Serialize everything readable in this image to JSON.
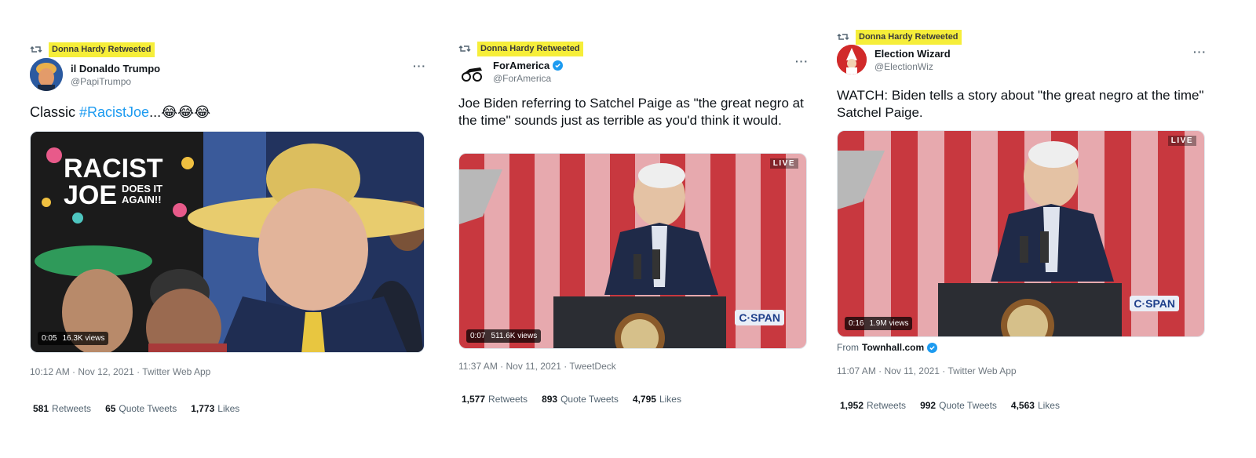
{
  "tweets": [
    {
      "retweeted_by": "Donna Hardy Retweeted",
      "display_name": "il Donaldo Trumpo",
      "handle": "@PapiTrumpo",
      "text_prefix": "Classic ",
      "hashtag": "#RacistJoe",
      "text_suffix": "...😂😂😂",
      "media_text_line1": "RACIST",
      "media_text_line2": "JOE",
      "media_text_line3": "DOES IT",
      "media_text_line4": "AGAIN!!",
      "video_time": "0:05",
      "video_views": "16.3K views",
      "timestamp": "10:12 AM · Nov 12, 2021 · Twitter Web App",
      "retweets_count": "581",
      "retweets_label": "Retweets",
      "quote_count": "65",
      "quote_label": "Quote Tweets",
      "likes_count": "1,773",
      "likes_label": "Likes"
    },
    {
      "retweeted_by": "Donna Hardy Retweeted",
      "display_name": "ForAmerica",
      "handle": "@ForAmerica",
      "text": "Joe Biden referring to Satchel Paige as \"the great negro at the time\" sounds just as terrible as you'd think it would.",
      "live_label": "LIVE",
      "network_label": "C·SPAN",
      "video_time": "0:07",
      "video_views": "511.6K views",
      "timestamp": "11:37 AM · Nov 11, 2021 · TweetDeck",
      "retweets_count": "1,577",
      "retweets_label": "Retweets",
      "quote_count": "893",
      "quote_label": "Quote Tweets",
      "likes_count": "4,795",
      "likes_label": "Likes"
    },
    {
      "retweeted_by": "Donna Hardy Retweeted",
      "display_name": "Election Wizard",
      "handle": "@ElectionWiz",
      "text": "WATCH: Biden tells a story about \"the great negro at the time\" Satchel Paige.",
      "live_label": "LIVE",
      "network_label": "C·SPAN",
      "video_time": "0:16",
      "video_views": "1.9M views",
      "from_label": "From",
      "from_source": "Townhall.com",
      "timestamp": "11:07 AM · Nov 11, 2021 · Twitter Web App",
      "retweets_count": "1,952",
      "retweets_label": "Retweets",
      "quote_count": "992",
      "quote_label": "Quote Tweets",
      "likes_count": "4,563",
      "likes_label": "Likes"
    }
  ],
  "more_glyph": "···",
  "colors": {
    "highlight": "#f6ee3a",
    "twitter_blue": "#1d9bf0",
    "flag_red": "#c8383f",
    "flag_pink": "#e7a9ae"
  }
}
